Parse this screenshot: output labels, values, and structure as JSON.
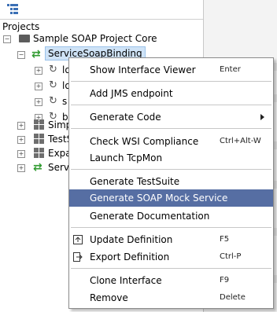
{
  "tree": {
    "header": "Projects",
    "project": "Sample SOAP Project Core",
    "binding": "ServiceSoapBinding",
    "ops": [
      "lo",
      "lo",
      "s",
      "b"
    ],
    "services": [
      "Simp",
      "TestS",
      "Expa",
      "Servi"
    ]
  },
  "menu": {
    "items": [
      {
        "label": "Show Interface Viewer",
        "shortcut": "Enter"
      },
      {
        "label": "Add JMS endpoint",
        "shortcut": ""
      },
      {
        "label": "Generate Code",
        "shortcut": ""
      },
      {
        "label": "Check WSI Compliance",
        "shortcut": "Ctrl+Alt-W"
      },
      {
        "label": "Launch TcpMon",
        "shortcut": ""
      },
      {
        "label": "Generate TestSuite",
        "shortcut": ""
      },
      {
        "label": "Generate SOAP Mock Service",
        "shortcut": ""
      },
      {
        "label": "Generate Documentation",
        "shortcut": ""
      },
      {
        "label": "Update Definition",
        "shortcut": "F5"
      },
      {
        "label": "Export Definition",
        "shortcut": "Ctrl-P"
      },
      {
        "label": "Clone Interface",
        "shortcut": "F9"
      },
      {
        "label": "Remove",
        "shortcut": "Delete"
      }
    ]
  },
  "colors": {
    "highlight": "#566ea3",
    "selection": "#cfe3f7"
  }
}
